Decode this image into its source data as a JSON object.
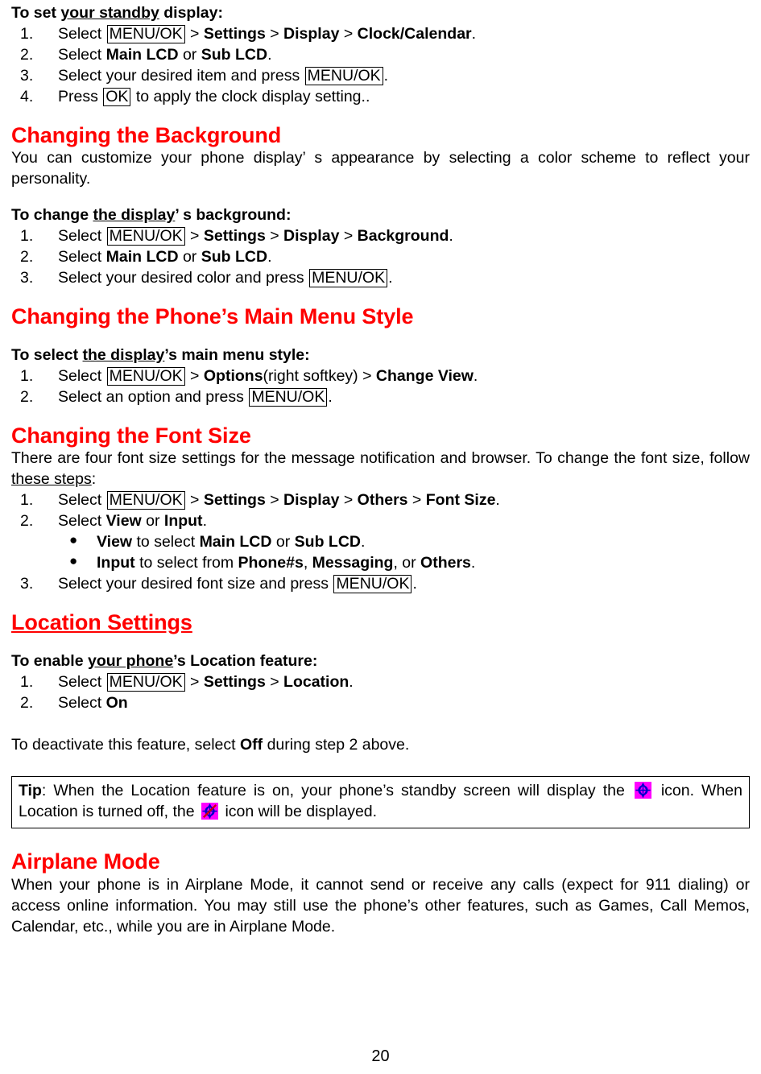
{
  "document": {
    "page_number": "20",
    "accent_color": "#ff0000",
    "icon_background_color": "#ff00ff",
    "icon_glyph_color": "#0000cc",
    "icon_slash_color": "#cc0000"
  },
  "standby": {
    "heading_prefix": "To set ",
    "heading_underlined": "your standby",
    "heading_suffix": " display:",
    "steps": [
      {
        "num": "1.",
        "pre": "Select ",
        "key": "MENU/OK",
        "post_plain_1": " > ",
        "bold_1": "Settings",
        "post_plain_2": " > ",
        "bold_2": "Display",
        "post_plain_3": " > ",
        "bold_3": "Clock/Calendar",
        "tail": "."
      },
      {
        "num": "2.",
        "pre": "Select ",
        "bold_1": "Main LCD",
        "mid": " or ",
        "bold_2": "Sub LCD",
        "tail": "."
      },
      {
        "num": "3.",
        "pre": "Select your desired item and press ",
        "key": "MENU/OK",
        "tail": "."
      },
      {
        "num": "4.",
        "pre": "Press ",
        "key": "OK",
        "post": " to apply the clock display setting.."
      }
    ]
  },
  "background_section": {
    "heading": "Changing the Background",
    "intro": "You can customize your phone display’ s appearance by selecting a color scheme to reflect your personality.",
    "subheading_prefix": "To change ",
    "subheading_underlined": "the display",
    "subheading_suffix": "’ s background:",
    "steps": [
      {
        "num": "1.",
        "pre": "Select ",
        "key": "MENU/OK",
        "post_plain_1": " > ",
        "bold_1": "Settings",
        "post_plain_2": " > ",
        "bold_2": "Display",
        "post_plain_3": " > ",
        "bold_3": "Background",
        "tail": "."
      },
      {
        "num": "2.",
        "pre": "Select ",
        "bold_1": "Main LCD",
        "mid": " or ",
        "bold_2": "Sub LCD",
        "tail": "."
      },
      {
        "num": "3.",
        "pre": "Select your desired color and press ",
        "key": "MENU/OK",
        "tail": "."
      }
    ]
  },
  "main_menu_section": {
    "heading": "Changing the Phone’s Main Menu Style",
    "subheading_prefix": "To select ",
    "subheading_underlined": "the display",
    "subheading_suffix": "’s main menu style:",
    "steps": [
      {
        "num": "1.",
        "pre": "Select ",
        "key": "MENU/OK",
        "post_plain_1": " > ",
        "bold_1": "Options",
        "plain_paren": "(right softkey)",
        "post_plain_2": " > ",
        "bold_2": "Change View",
        "tail": "."
      },
      {
        "num": "2.",
        "pre": "Select an option and press ",
        "key": "MENU/OK",
        "tail": "."
      }
    ]
  },
  "font_size_section": {
    "heading": "Changing the Font Size",
    "intro_1": "There are four font size settings for the message notification and browser. To change the font size, follow ",
    "intro_underlined": "these steps",
    "intro_2": ":",
    "steps": [
      {
        "num": "1.",
        "pre": "Select ",
        "key": "MENU/OK",
        "post_plain_1": " > ",
        "bold_1": "Settings",
        "post_plain_2": " > ",
        "bold_2": "Display",
        "post_plain_3": " > ",
        "bold_3": "Others",
        "post_plain_4": " > ",
        "bold_4": "Font Size",
        "tail": "."
      },
      {
        "num": "2.",
        "pre": "Select ",
        "bold_1": "View",
        "mid": " or ",
        "bold_2": "Input",
        "tail": "."
      }
    ],
    "bullets": [
      {
        "bold_1": "View",
        "mid_1": " to select ",
        "bold_2": "Main LCD",
        "mid_2": " or ",
        "bold_3": "Sub LCD",
        "tail": "."
      },
      {
        "bold_1": "Input",
        "mid_1": " to select from ",
        "bold_2": "Phone#s",
        "mid_2": ", ",
        "bold_3": "Messaging",
        "mid_3": ", or ",
        "bold_4": "Others",
        "tail": "."
      }
    ],
    "last_step": {
      "num": "3.",
      "pre": "Select your desired font size and press ",
      "key": "MENU/OK",
      "tail": "."
    }
  },
  "location_section": {
    "heading": "Location Settings",
    "subheading_prefix": "To enable ",
    "subheading_underlined": "your phone",
    "subheading_suffix": "’s Location feature:",
    "steps": [
      {
        "num": "1.",
        "pre": "Select ",
        "key": "MENU/OK",
        "post_plain_1": " > ",
        "bold_1": "Settings",
        "post_plain_2": " > ",
        "bold_2": "Location",
        "tail": "."
      },
      {
        "num": "2.",
        "pre": "Select ",
        "bold_1": "On"
      }
    ],
    "deactivate_1": "To deactivate this feature, select ",
    "deactivate_bold": "Off",
    "deactivate_2": " during step 2 above."
  },
  "tip": {
    "label": "Tip",
    "text_1": ": When the Location feature is on, your phone’s standby screen will display the ",
    "icon_on_name": "location-on-icon",
    "text_2": " icon. When Location is turned off, the ",
    "icon_off_name": "location-off-icon",
    "text_3": " icon will be displayed."
  },
  "airplane_section": {
    "heading": "Airplane Mode",
    "body": "When your phone is in Airplane Mode, it cannot send or receive any calls (expect for 911 dialing) or access online information. You may still use the phone’s other features, such as Games, Call Memos, Calendar, etc., while you are in Airplane Mode."
  }
}
